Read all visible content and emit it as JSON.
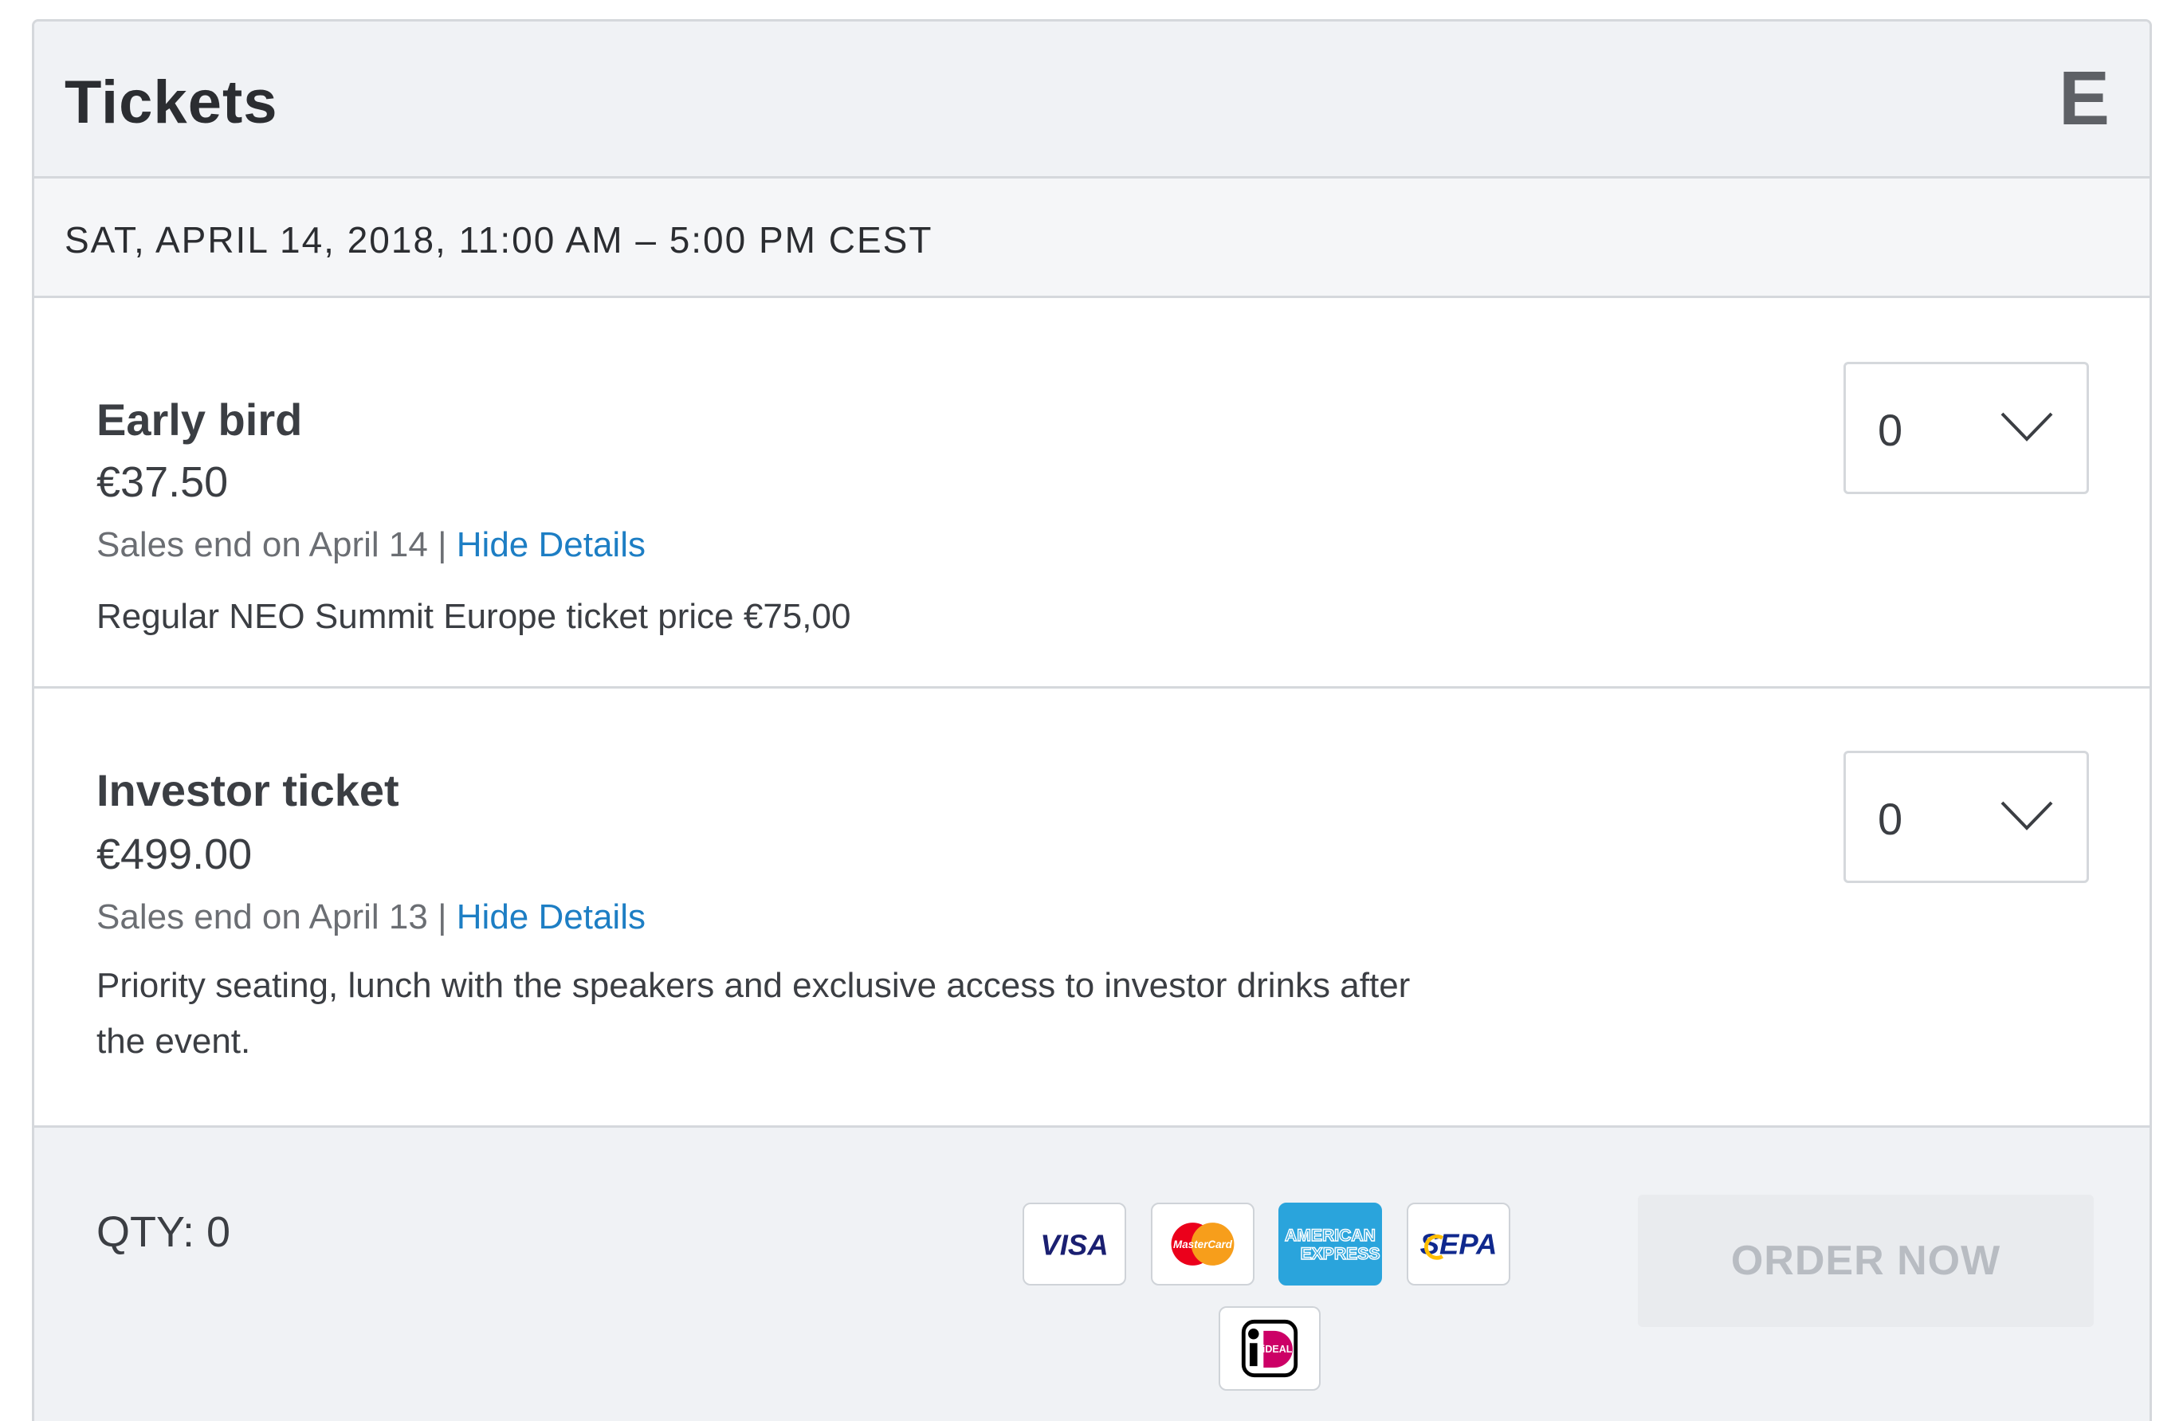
{
  "header": {
    "title": "Tickets",
    "logo_letter": "E"
  },
  "event": {
    "date": "SAT, APRIL 14, 2018, 11:00 AM – 5:00 PM CEST"
  },
  "tickets": [
    {
      "name": "Early bird",
      "price": "€37.50",
      "sales_end": "Sales end on April 14",
      "separator": "|",
      "details_link": "Hide Details",
      "description": "Regular NEO Summit Europe ticket price €75,00",
      "quantity": "0"
    },
    {
      "name": "Investor ticket",
      "price": "€499.00",
      "sales_end": "Sales end on April 13",
      "separator": "|",
      "details_link": "Hide Details",
      "description": "Priority seating, lunch with the speakers and exclusive access to investor drinks after the event.",
      "quantity": "0"
    }
  ],
  "footer": {
    "qty_label": "QTY: 0",
    "order_button": "ORDER NOW",
    "payment_methods": [
      {
        "name": "visa",
        "label": "VISA"
      },
      {
        "name": "mastercard",
        "label": "MasterCard"
      },
      {
        "name": "american-express",
        "label_line1": "AMERICAN",
        "label_line2": "EXPRESS"
      },
      {
        "name": "sepa",
        "label": "SEPA"
      },
      {
        "name": "ideal",
        "label": "iDEAL"
      }
    ]
  },
  "colors": {
    "link": "#1d7ec4",
    "header_bg": "#f0f2f5",
    "border": "#d5d8dc",
    "disabled_button_bg": "#e9ebee",
    "disabled_button_text": "#b8bcc2"
  }
}
